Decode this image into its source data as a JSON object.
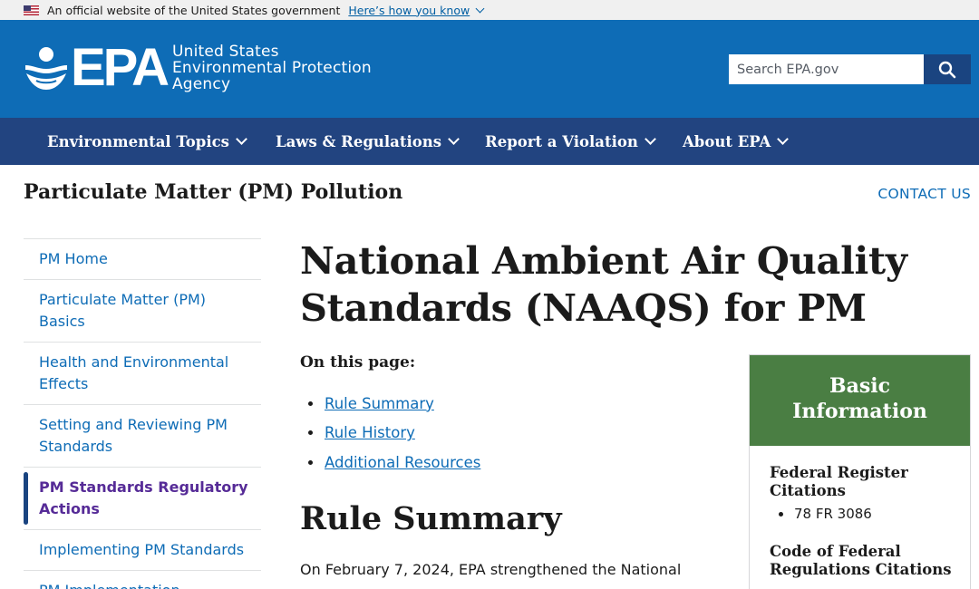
{
  "gov_banner": {
    "text": "An official website of the United States government",
    "link": "Here’s how you know"
  },
  "header": {
    "logo_text": "EPA",
    "agency_line1": "United States",
    "agency_line2": "Environmental Protection",
    "agency_line3": "Agency",
    "search_placeholder": "Search EPA.gov",
    "search_icon": "search-icon",
    "colors": {
      "header_bg": "#0e6cb6",
      "nav_bg": "#224480",
      "search_button": "#1a4480"
    }
  },
  "nav": {
    "items": [
      {
        "label": "Environmental Topics"
      },
      {
        "label": "Laws & Regulations"
      },
      {
        "label": "Report a Violation"
      },
      {
        "label": "About EPA"
      }
    ]
  },
  "section": {
    "title": "Particulate Matter (PM) Pollution",
    "contact": "CONTACT US"
  },
  "sidebar": {
    "items": [
      {
        "label": "PM Home"
      },
      {
        "label": "Particulate Matter (PM) Basics"
      },
      {
        "label": "Health and Environmental Effects"
      },
      {
        "label": "Setting and Reviewing PM Standards"
      },
      {
        "label": "PM Standards Regulatory Actions",
        "active": true
      },
      {
        "label": "Implementing PM Standards"
      },
      {
        "label": "PM Implementation"
      }
    ]
  },
  "main": {
    "title": "National Ambient Air Quality Standards (NAAQS) for PM",
    "on_this_page": "On this page:",
    "toc": [
      {
        "label": "Rule Summary"
      },
      {
        "label": "Rule History"
      },
      {
        "label": "Additional Resources"
      }
    ],
    "h2": "Rule Summary",
    "paragraph": "On February 7, 2024, EPA strengthened the National"
  },
  "info_box": {
    "title": "Basic Information",
    "color": "#4a7e43",
    "sections": [
      {
        "heading": "Federal Register Citations",
        "items": [
          "78 FR 3086"
        ]
      },
      {
        "heading": "Code of Federal Regulations Citations",
        "items": []
      }
    ]
  }
}
